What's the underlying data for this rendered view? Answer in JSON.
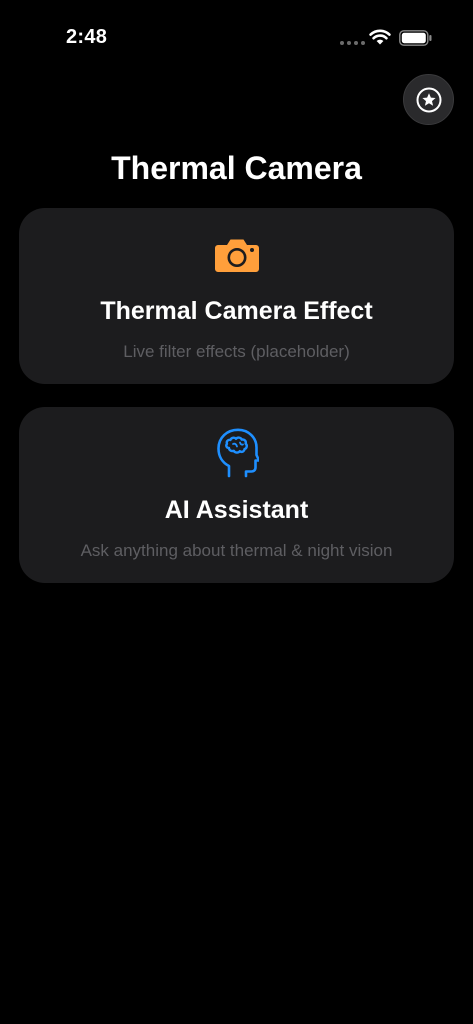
{
  "status_bar": {
    "time": "2:48"
  },
  "header": {
    "favorite_icon": "star-circle-icon",
    "title": "Thermal Camera"
  },
  "cards": [
    {
      "icon": "camera-icon",
      "icon_color": "#FF9F3B",
      "title": "Thermal Camera Effect",
      "subtitle": "Live filter effects (placeholder)"
    },
    {
      "icon": "brain-head-icon",
      "icon_color": "#1E8FFF",
      "title": "AI Assistant",
      "subtitle": "Ask anything about thermal & night vision"
    }
  ],
  "colors": {
    "background": "#000000",
    "card": "#1C1C1E",
    "subtitle_text": "#5E5E62"
  }
}
